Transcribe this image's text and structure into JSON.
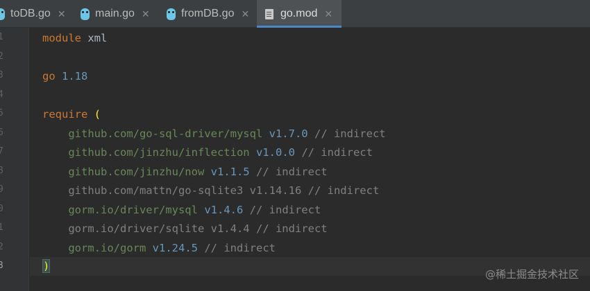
{
  "tabs": [
    {
      "label": "toDB.go",
      "icon": "go-file-icon"
    },
    {
      "label": "main.go",
      "icon": "go-file-icon"
    },
    {
      "label": "fromDB.go",
      "icon": "go-file-icon"
    },
    {
      "label": "go.mod",
      "icon": "mod-file-icon",
      "active": true
    }
  ],
  "gutter": [
    "1",
    "2",
    "3",
    "4",
    "5",
    "6",
    "7",
    "8",
    "9",
    "0",
    "1",
    "2",
    "3"
  ],
  "code": {
    "l1": {
      "kw": "module",
      "rest": " xml"
    },
    "l3": {
      "kw": "go",
      "ver": " 1.18"
    },
    "l5": {
      "kw": "require",
      "paren": "("
    },
    "deps": [
      {
        "path": "github.com/go-sql-driver/mysql",
        "ver": "v1.7.0",
        "comment": "// indirect"
      },
      {
        "path": "github.com/jinzhu/inflection",
        "ver": "v1.0.0",
        "comment": "// indirect"
      },
      {
        "path": "github.com/jinzhu/now",
        "ver": "v1.1.5",
        "comment": "// indirect"
      },
      {
        "path": "github.com/mattn/go-sqlite3",
        "ver": "v1.14.16",
        "comment": "// indirect"
      },
      {
        "path": "gorm.io/driver/mysql",
        "ver": "v1.4.6",
        "comment": "// indirect"
      },
      {
        "path": "gorm.io/driver/sqlite",
        "ver": "v1.4.4",
        "comment": "// indirect"
      },
      {
        "path": "gorm.io/gorm",
        "ver": "v1.24.5",
        "comment": "// indirect"
      }
    ],
    "close_paren": ")"
  },
  "watermark": "@稀土掘金技术社区",
  "colors": {
    "keyword": "#cc7832",
    "path": "#6a8759",
    "version": "#6897bb",
    "comment": "#808080",
    "accent": "#4a88c7"
  }
}
